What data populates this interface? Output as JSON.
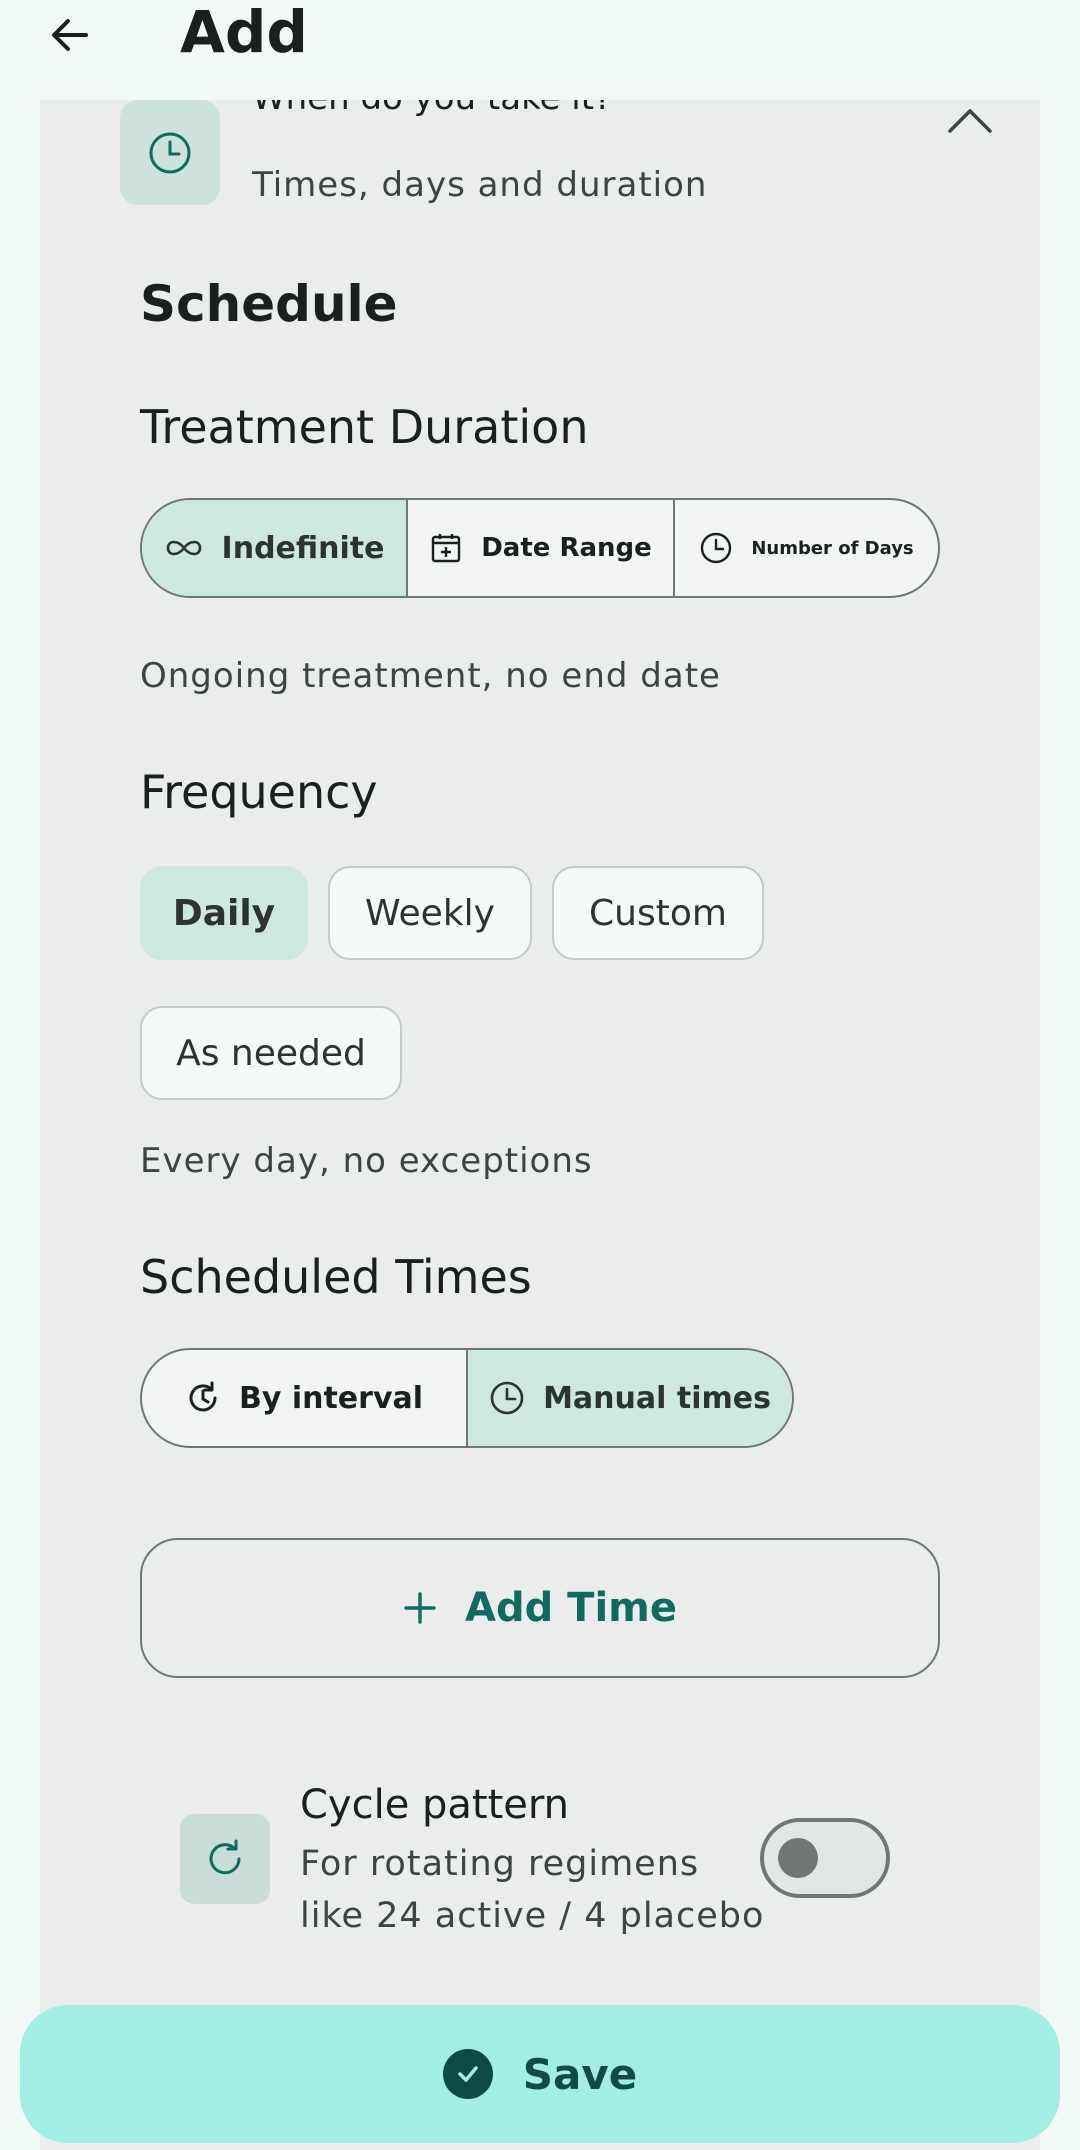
{
  "header": {
    "title": "Add",
    "back_icon": "arrow-left-icon"
  },
  "section": {
    "icon": "clock-icon",
    "title": "When do you take it?",
    "subtitle": "Times, days and duration",
    "collapse_icon": "chevron-up-icon"
  },
  "schedule": {
    "heading": "Schedule",
    "duration": {
      "heading": "Treatment Duration",
      "options": [
        {
          "label": "Indefinite",
          "icon": "infinity-icon",
          "selected": true
        },
        {
          "label": "Date Range",
          "icon": "calendar-add-icon",
          "selected": false
        },
        {
          "label": "Number of Days",
          "icon": "clock-icon",
          "selected": false
        }
      ],
      "helper": "Ongoing treatment, no end date"
    },
    "frequency": {
      "heading": "Frequency",
      "options": [
        {
          "label": "Daily",
          "selected": true
        },
        {
          "label": "Weekly",
          "selected": false
        },
        {
          "label": "Custom",
          "selected": false
        },
        {
          "label": "As needed",
          "selected": false
        }
      ],
      "helper": "Every day, no exceptions"
    },
    "times": {
      "heading": "Scheduled Times",
      "options": [
        {
          "label": "By interval",
          "icon": "interval-icon",
          "selected": false
        },
        {
          "label": "Manual times",
          "icon": "clock-icon",
          "selected": true
        }
      ],
      "add_label": "Add Time"
    },
    "cycle": {
      "title": "Cycle pattern",
      "description": "For rotating regimens like 24 active / 4 placebo",
      "enabled": false
    }
  },
  "save": {
    "label": "Save"
  },
  "colors": {
    "accent": "#0f6b60",
    "selected_bg": "#cde7e1",
    "save_bg": "#a3eee2"
  }
}
